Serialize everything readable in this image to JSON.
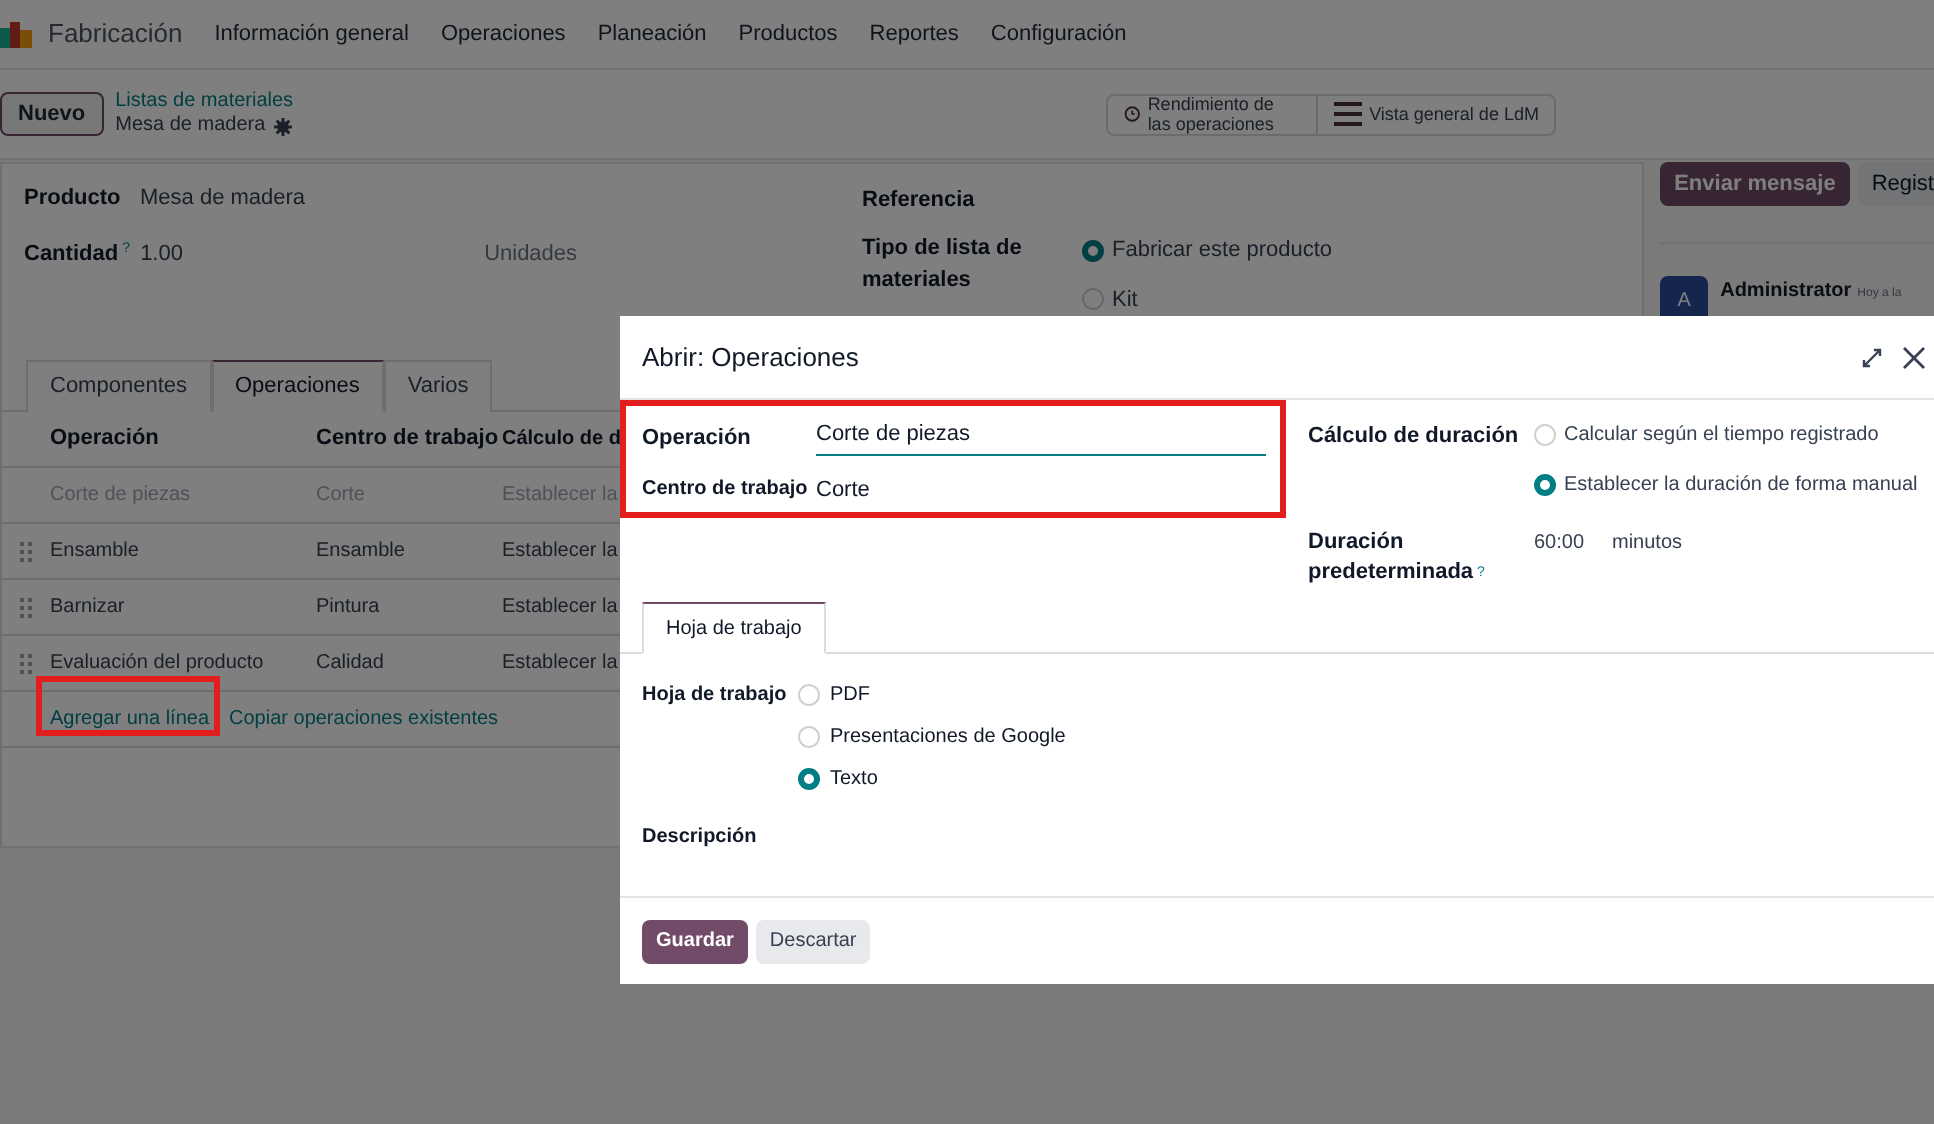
{
  "app": {
    "name": "Fabricación",
    "menu": [
      "Información general",
      "Operaciones",
      "Planeación",
      "Productos",
      "Reportes",
      "Configuración"
    ]
  },
  "control_panel": {
    "new_button": "Nuevo",
    "breadcrumb": "Listas de materiales",
    "record": "Mesa de madera",
    "smart_buttons": [
      {
        "kind": "clock",
        "label": "Rendimiento de las operaciones"
      },
      {
        "kind": "list",
        "label": "Vista general de LdM"
      }
    ]
  },
  "form": {
    "product_label": "Producto",
    "product": "Mesa de madera",
    "quantity_label": "Cantidad",
    "quantity_help": "?",
    "quantity": "1.00",
    "unit": "Unidades",
    "reference_label": "Referencia",
    "type_label": "Tipo de lista de materiales",
    "type_options": [
      {
        "label": "Fabricar este producto",
        "selected": true
      },
      {
        "label": "Kit",
        "selected": false
      }
    ],
    "tabs": [
      {
        "label": "Componentes",
        "selected": false
      },
      {
        "label": "Operaciones",
        "selected": true
      },
      {
        "label": "Varios",
        "selected": false
      }
    ],
    "columns": [
      "Operación",
      "Centro de trabajo",
      "Cálculo de d"
    ],
    "rows": [
      {
        "cells": [
          "Corte de piezas",
          "Corte",
          "Establecer la"
        ],
        "editing": true
      },
      {
        "cells": [
          "Ensamble",
          "Ensamble",
          "Establecer la"
        ],
        "editing": false
      },
      {
        "cells": [
          "Barnizar",
          "Pintura",
          "Establecer la"
        ],
        "editing": false
      },
      {
        "cells": [
          "Evaluación del producto",
          "Calidad",
          "Establecer la"
        ],
        "editing": false
      }
    ],
    "links": [
      "Agregar una línea",
      "Copiar operaciones existentes"
    ]
  },
  "chatter": {
    "buttons": [
      {
        "label": "Enviar mensaje",
        "primary": true
      },
      {
        "label": "Regist",
        "primary": false
      }
    ],
    "avatar": "A",
    "author": "Administrator",
    "time": "Hoy a la"
  },
  "dialog": {
    "title": "Abrir: Operaciones",
    "operation_label": "Operación",
    "operation": "Corte de piezas",
    "workcenter_label": "Centro de trabajo",
    "workcenter": "Corte",
    "duration_calc_label": "Cálculo de duración",
    "duration_calc_options": [
      {
        "label": "Calcular según el tiempo registrado",
        "selected": false
      },
      {
        "label": "Establecer la duración de forma manual",
        "selected": true
      }
    ],
    "default_duration_label": "Duración predeterminada",
    "default_duration_help": "?",
    "default_duration": "60:00",
    "duration_unit": "minutos",
    "tabs": [
      {
        "label": "Hoja de trabajo",
        "selected": true
      }
    ],
    "worksheet_label": "Hoja de trabajo",
    "worksheet_options": [
      {
        "label": "PDF",
        "selected": false
      },
      {
        "label": "Presentaciones de Google",
        "selected": false
      },
      {
        "label": "Texto",
        "selected": true
      }
    ],
    "description_label": "Descripción",
    "buttons": [
      {
        "label": "Guardar",
        "primary": true
      },
      {
        "label": "Descartar",
        "primary": false
      }
    ]
  }
}
